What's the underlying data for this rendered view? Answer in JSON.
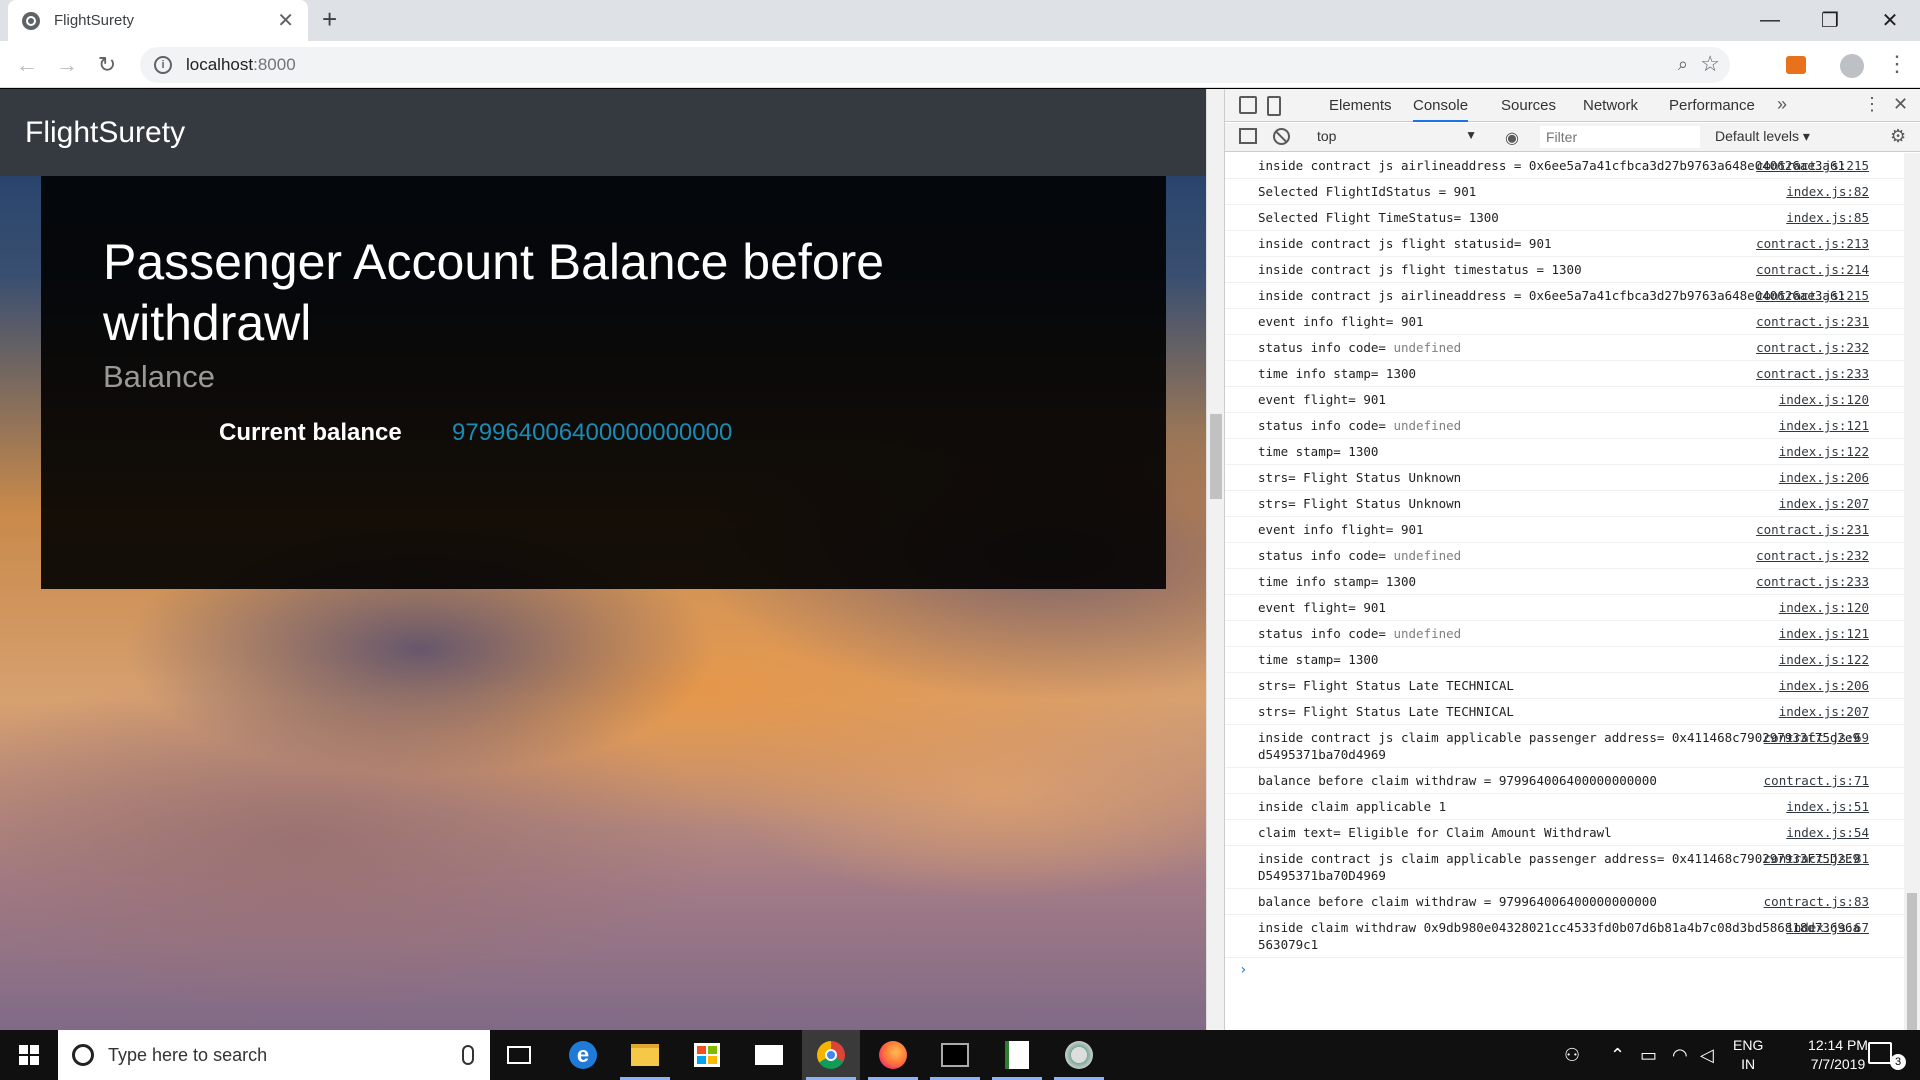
{
  "browser": {
    "tab_title": "FlightSurety",
    "tab_close": "✕",
    "new_tab": "+",
    "url_host": "localhost",
    "url_port": ":8000",
    "window_controls": {
      "minimize": "—",
      "restore": "❐",
      "close": "✕"
    }
  },
  "page": {
    "brand": "FlightSurety",
    "heading": "Passenger Account Balance before withdrawl",
    "subheading": "Balance",
    "current_balance_label": "Current balance",
    "current_balance_value": "979964006400000000000"
  },
  "devtools": {
    "tabs": [
      "Elements",
      "Console",
      "Sources",
      "Network",
      "Performance"
    ],
    "active_tab": "Console",
    "overflow": "»",
    "context": "top",
    "filter_placeholder": "Filter",
    "levels": "Default levels ▾",
    "console_rows": [
      {
        "msg": "inside contract js airlineaddress = 0x6ee5a7a41cfbca3d27b9763a648e040626ae3a61",
        "src": "contract.js:215"
      },
      {
        "msg": "Selected FlightIdStatus = 901",
        "src": "index.js:82"
      },
      {
        "msg": "Selected Flight TimeStatus= 1300",
        "src": "index.js:85"
      },
      {
        "msg": "inside contract js flight statusid= 901",
        "src": "contract.js:213"
      },
      {
        "msg": "inside contract js flight timestatus = 1300",
        "src": "contract.js:214"
      },
      {
        "msg": "inside contract js airlineaddress = 0x6ee5a7a41cfbca3d27b9763a648e040626ae3a61",
        "src": "contract.js:215"
      },
      {
        "msg": "event info flight= 901",
        "src": "contract.js:231"
      },
      {
        "msg": "status info code=",
        "undef": "undefined",
        "src": "contract.js:232"
      },
      {
        "msg": "time info stamp= 1300",
        "src": "contract.js:233"
      },
      {
        "msg": "event flight= 901",
        "src": "index.js:120"
      },
      {
        "msg": "status info code=",
        "undef": "undefined",
        "src": "index.js:121"
      },
      {
        "msg": "time stamp= 1300",
        "src": "index.js:122"
      },
      {
        "msg": "strs= Flight Status Unknown",
        "src": "index.js:206"
      },
      {
        "msg": "strs= Flight Status Unknown",
        "src": "index.js:207"
      },
      {
        "msg": "event info flight= 901",
        "src": "contract.js:231"
      },
      {
        "msg": "status info code=",
        "undef": "undefined",
        "src": "contract.js:232"
      },
      {
        "msg": "time info stamp= 1300",
        "src": "contract.js:233"
      },
      {
        "msg": "event flight= 901",
        "src": "index.js:120"
      },
      {
        "msg": "status info code=",
        "undef": "undefined",
        "src": "index.js:121"
      },
      {
        "msg": "time stamp= 1300",
        "src": "index.js:122"
      },
      {
        "msg": "strs= Flight Status Late TECHNICAL",
        "src": "index.js:206"
      },
      {
        "msg": "strs= Flight Status Late TECHNICAL",
        "src": "index.js:207"
      },
      {
        "msg": "inside contract js claim applicable passenger address= 0x411468c790297933f75d2e9d5495371ba70d4969",
        "src": "contract.js:69"
      },
      {
        "msg": "balance before claim withdraw = 979964006400000000000",
        "src": "contract.js:71"
      },
      {
        "msg": "inside claim applicable 1",
        "src": "index.js:51"
      },
      {
        "msg": "claim text= Eligible for Claim Amount Withdrawl",
        "src": "index.js:54"
      },
      {
        "msg": "inside contract js claim applicable passenger address= 0x411468c790297933F75D2E9D5495371ba70D4969",
        "src": "contract.js:81"
      },
      {
        "msg": "balance before claim withdraw = 979964006400000000000",
        "src": "contract.js:83"
      },
      {
        "msg": "inside claim withdraw 0x9db980e04328021cc4533fd0b07d6b81a4b7c08d3bd586818d73696a563079c1",
        "src": "index.js:67"
      }
    ],
    "prompt": "›"
  },
  "taskbar": {
    "search_placeholder": "Type here to search",
    "lang_top": "ENG",
    "lang_bottom": "IN",
    "time": "12:14 PM",
    "date": "7/7/2019",
    "notification_count": "3"
  }
}
